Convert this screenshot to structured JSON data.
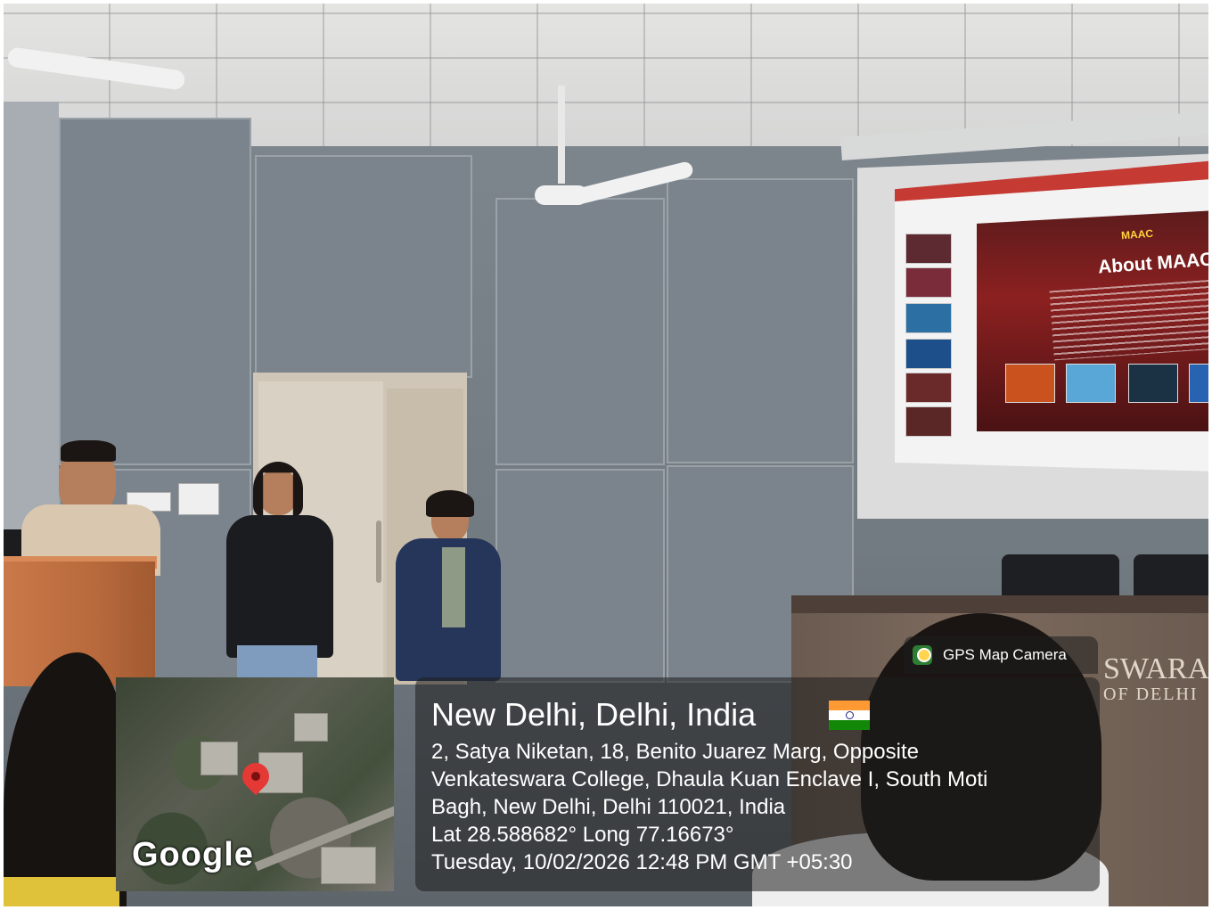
{
  "screen_slide": {
    "logo": "MAAC",
    "title": "About MAAC"
  },
  "desk_sign": {
    "line1": "SWARA",
    "line2": "OF DELHI"
  },
  "map": {
    "provider_logo": "Google"
  },
  "gps_overlay": {
    "app_name": "GPS Map Camera",
    "city_line": "New Delhi, Delhi, India",
    "flag_icon": "india-flag-icon",
    "address_lines": [
      "2, Satya Niketan, 18, Benito Juarez Marg, Opposite",
      "Venkateswara College, Dhaula Kuan Enclave I, South Moti",
      "Bagh, New Delhi, Delhi 110021, India"
    ],
    "coordinates": "Lat 28.588682° Long 77.16673°",
    "datetime": "Tuesday, 10/02/2026 12:48 PM GMT +05:30"
  },
  "colors": {
    "overlay_bg": "rgba(30,30,30,0.55)",
    "pin": "#e53935",
    "slide_accent": "#c63a34"
  }
}
